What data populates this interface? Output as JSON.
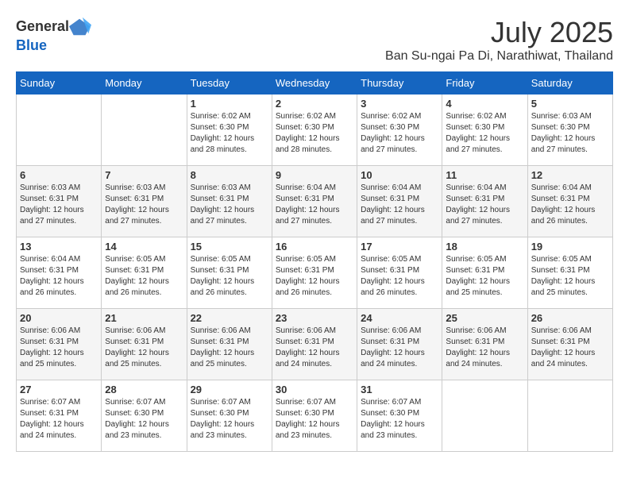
{
  "logo": {
    "general": "General",
    "blue": "Blue"
  },
  "title": {
    "month_year": "July 2025",
    "location": "Ban Su-ngai Pa Di, Narathiwat, Thailand"
  },
  "weekdays": [
    "Sunday",
    "Monday",
    "Tuesday",
    "Wednesday",
    "Thursday",
    "Friday",
    "Saturday"
  ],
  "weeks": [
    [
      {
        "day": "",
        "sunrise": "",
        "sunset": "",
        "daylight": ""
      },
      {
        "day": "",
        "sunrise": "",
        "sunset": "",
        "daylight": ""
      },
      {
        "day": "1",
        "sunrise": "Sunrise: 6:02 AM",
        "sunset": "Sunset: 6:30 PM",
        "daylight": "Daylight: 12 hours and 28 minutes."
      },
      {
        "day": "2",
        "sunrise": "Sunrise: 6:02 AM",
        "sunset": "Sunset: 6:30 PM",
        "daylight": "Daylight: 12 hours and 28 minutes."
      },
      {
        "day": "3",
        "sunrise": "Sunrise: 6:02 AM",
        "sunset": "Sunset: 6:30 PM",
        "daylight": "Daylight: 12 hours and 27 minutes."
      },
      {
        "day": "4",
        "sunrise": "Sunrise: 6:02 AM",
        "sunset": "Sunset: 6:30 PM",
        "daylight": "Daylight: 12 hours and 27 minutes."
      },
      {
        "day": "5",
        "sunrise": "Sunrise: 6:03 AM",
        "sunset": "Sunset: 6:30 PM",
        "daylight": "Daylight: 12 hours and 27 minutes."
      }
    ],
    [
      {
        "day": "6",
        "sunrise": "Sunrise: 6:03 AM",
        "sunset": "Sunset: 6:31 PM",
        "daylight": "Daylight: 12 hours and 27 minutes."
      },
      {
        "day": "7",
        "sunrise": "Sunrise: 6:03 AM",
        "sunset": "Sunset: 6:31 PM",
        "daylight": "Daylight: 12 hours and 27 minutes."
      },
      {
        "day": "8",
        "sunrise": "Sunrise: 6:03 AM",
        "sunset": "Sunset: 6:31 PM",
        "daylight": "Daylight: 12 hours and 27 minutes."
      },
      {
        "day": "9",
        "sunrise": "Sunrise: 6:04 AM",
        "sunset": "Sunset: 6:31 PM",
        "daylight": "Daylight: 12 hours and 27 minutes."
      },
      {
        "day": "10",
        "sunrise": "Sunrise: 6:04 AM",
        "sunset": "Sunset: 6:31 PM",
        "daylight": "Daylight: 12 hours and 27 minutes."
      },
      {
        "day": "11",
        "sunrise": "Sunrise: 6:04 AM",
        "sunset": "Sunset: 6:31 PM",
        "daylight": "Daylight: 12 hours and 27 minutes."
      },
      {
        "day": "12",
        "sunrise": "Sunrise: 6:04 AM",
        "sunset": "Sunset: 6:31 PM",
        "daylight": "Daylight: 12 hours and 26 minutes."
      }
    ],
    [
      {
        "day": "13",
        "sunrise": "Sunrise: 6:04 AM",
        "sunset": "Sunset: 6:31 PM",
        "daylight": "Daylight: 12 hours and 26 minutes."
      },
      {
        "day": "14",
        "sunrise": "Sunrise: 6:05 AM",
        "sunset": "Sunset: 6:31 PM",
        "daylight": "Daylight: 12 hours and 26 minutes."
      },
      {
        "day": "15",
        "sunrise": "Sunrise: 6:05 AM",
        "sunset": "Sunset: 6:31 PM",
        "daylight": "Daylight: 12 hours and 26 minutes."
      },
      {
        "day": "16",
        "sunrise": "Sunrise: 6:05 AM",
        "sunset": "Sunset: 6:31 PM",
        "daylight": "Daylight: 12 hours and 26 minutes."
      },
      {
        "day": "17",
        "sunrise": "Sunrise: 6:05 AM",
        "sunset": "Sunset: 6:31 PM",
        "daylight": "Daylight: 12 hours and 26 minutes."
      },
      {
        "day": "18",
        "sunrise": "Sunrise: 6:05 AM",
        "sunset": "Sunset: 6:31 PM",
        "daylight": "Daylight: 12 hours and 25 minutes."
      },
      {
        "day": "19",
        "sunrise": "Sunrise: 6:05 AM",
        "sunset": "Sunset: 6:31 PM",
        "daylight": "Daylight: 12 hours and 25 minutes."
      }
    ],
    [
      {
        "day": "20",
        "sunrise": "Sunrise: 6:06 AM",
        "sunset": "Sunset: 6:31 PM",
        "daylight": "Daylight: 12 hours and 25 minutes."
      },
      {
        "day": "21",
        "sunrise": "Sunrise: 6:06 AM",
        "sunset": "Sunset: 6:31 PM",
        "daylight": "Daylight: 12 hours and 25 minutes."
      },
      {
        "day": "22",
        "sunrise": "Sunrise: 6:06 AM",
        "sunset": "Sunset: 6:31 PM",
        "daylight": "Daylight: 12 hours and 25 minutes."
      },
      {
        "day": "23",
        "sunrise": "Sunrise: 6:06 AM",
        "sunset": "Sunset: 6:31 PM",
        "daylight": "Daylight: 12 hours and 24 minutes."
      },
      {
        "day": "24",
        "sunrise": "Sunrise: 6:06 AM",
        "sunset": "Sunset: 6:31 PM",
        "daylight": "Daylight: 12 hours and 24 minutes."
      },
      {
        "day": "25",
        "sunrise": "Sunrise: 6:06 AM",
        "sunset": "Sunset: 6:31 PM",
        "daylight": "Daylight: 12 hours and 24 minutes."
      },
      {
        "day": "26",
        "sunrise": "Sunrise: 6:06 AM",
        "sunset": "Sunset: 6:31 PM",
        "daylight": "Daylight: 12 hours and 24 minutes."
      }
    ],
    [
      {
        "day": "27",
        "sunrise": "Sunrise: 6:07 AM",
        "sunset": "Sunset: 6:31 PM",
        "daylight": "Daylight: 12 hours and 24 minutes."
      },
      {
        "day": "28",
        "sunrise": "Sunrise: 6:07 AM",
        "sunset": "Sunset: 6:30 PM",
        "daylight": "Daylight: 12 hours and 23 minutes."
      },
      {
        "day": "29",
        "sunrise": "Sunrise: 6:07 AM",
        "sunset": "Sunset: 6:30 PM",
        "daylight": "Daylight: 12 hours and 23 minutes."
      },
      {
        "day": "30",
        "sunrise": "Sunrise: 6:07 AM",
        "sunset": "Sunset: 6:30 PM",
        "daylight": "Daylight: 12 hours and 23 minutes."
      },
      {
        "day": "31",
        "sunrise": "Sunrise: 6:07 AM",
        "sunset": "Sunset: 6:30 PM",
        "daylight": "Daylight: 12 hours and 23 minutes."
      },
      {
        "day": "",
        "sunrise": "",
        "sunset": "",
        "daylight": ""
      },
      {
        "day": "",
        "sunrise": "",
        "sunset": "",
        "daylight": ""
      }
    ]
  ]
}
